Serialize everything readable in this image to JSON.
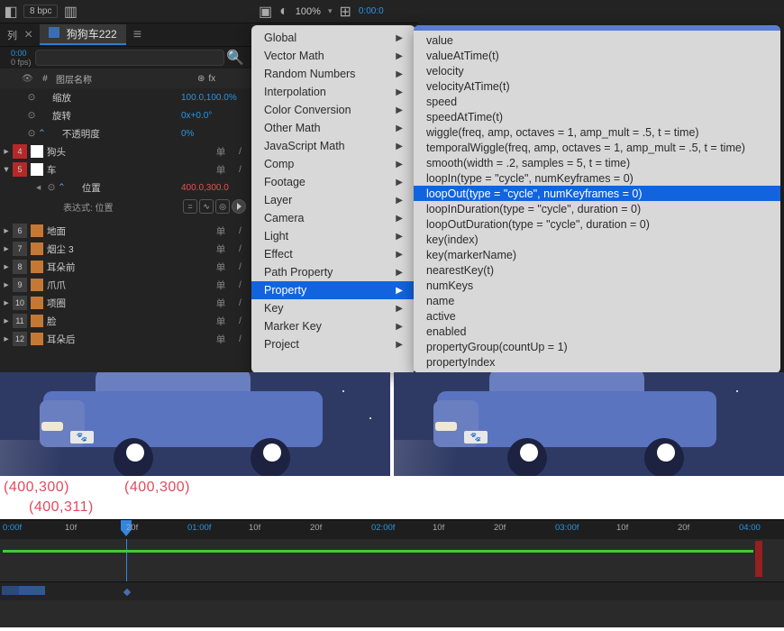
{
  "toolbar": {
    "bpc": "8 bpc",
    "zoom": "100%",
    "time": "0:00:0"
  },
  "composition": {
    "tab_name": "狗狗车222",
    "timecode_top": "0:00",
    "timecode_sub": "0 fps)"
  },
  "layer_header": {
    "hash": "#",
    "name": "图层名称"
  },
  "layers": {
    "scale": {
      "label": "缩放",
      "value": "100.0,100.0%"
    },
    "rotation": {
      "label": "旋转",
      "value": "0x+0.0°"
    },
    "opacity": {
      "label": "不透明度",
      "value": "0%"
    },
    "l4": {
      "num": "4",
      "name": "狗头"
    },
    "l5": {
      "num": "5",
      "name": "车"
    },
    "position": {
      "label": "位置",
      "value": "400.0,300.0"
    },
    "expression_label": "表达式: 位置",
    "l6": {
      "num": "6",
      "name": "地面"
    },
    "l7": {
      "num": "7",
      "name": "烟尘 3"
    },
    "l8": {
      "num": "8",
      "name": "耳朵前"
    },
    "l9": {
      "num": "9",
      "name": "爪爪"
    },
    "l10": {
      "num": "10",
      "name": "项圈"
    },
    "l11": {
      "num": "11",
      "name": "脸"
    },
    "l12": {
      "num": "12",
      "name": "耳朵后"
    }
  },
  "menu1": [
    "Global",
    "Vector Math",
    "Random Numbers",
    "Interpolation",
    "Color Conversion",
    "Other Math",
    "JavaScript Math",
    "Comp",
    "Footage",
    "Layer",
    "Camera",
    "Light",
    "Effect",
    "Path Property",
    "Property",
    "Key",
    "Marker Key",
    "Project"
  ],
  "menu1_highlight": 14,
  "menu2": [
    "value",
    "valueAtTime(t)",
    "velocity",
    "velocityAtTime(t)",
    "speed",
    "speedAtTime(t)",
    "wiggle(freq, amp, octaves = 1, amp_mult = .5, t = time)",
    "temporalWiggle(freq, amp, octaves = 1, amp_mult = .5, t = time)",
    "smooth(width = .2, samples = 5, t = time)",
    "loopIn(type = \"cycle\", numKeyframes = 0)",
    "loopOut(type = \"cycle\", numKeyframes = 0)",
    "loopInDuration(type = \"cycle\", duration = 0)",
    "loopOutDuration(type = \"cycle\", duration = 0)",
    "key(index)",
    "key(markerName)",
    "nearestKey(t)",
    "numKeys",
    "name",
    "active",
    "enabled",
    "propertyGroup(countUp = 1)",
    "propertyIndex"
  ],
  "menu2_highlight": 10,
  "coords": {
    "a": "(400,300)",
    "b": "(400,300)",
    "c": "(400,311)"
  },
  "ruler": {
    "ticks": [
      "0:00f",
      "10f",
      "20f",
      "01:00f",
      "10f",
      "20f",
      "02:00f",
      "10f",
      "20f",
      "03:00f",
      "10f",
      "20f",
      "04:00"
    ]
  },
  "switches": {
    "pin": "单",
    "slash": "/"
  }
}
